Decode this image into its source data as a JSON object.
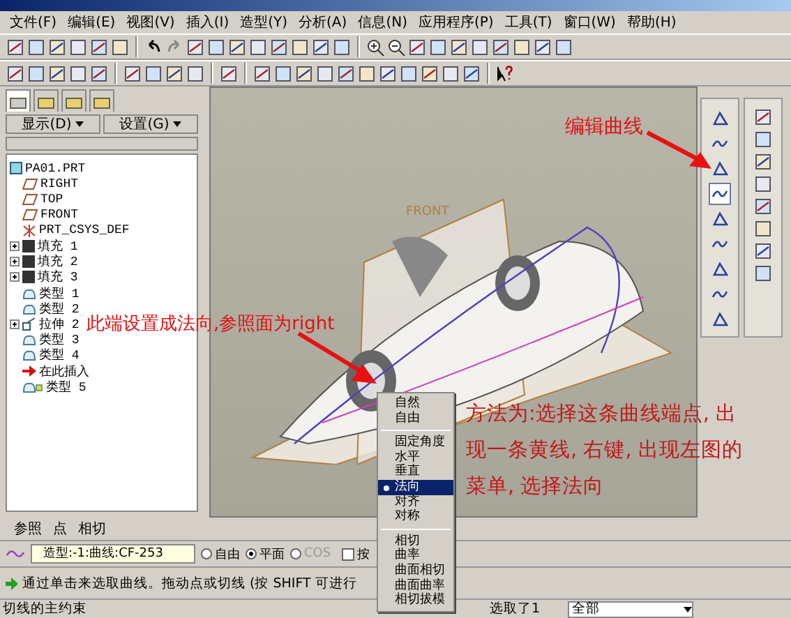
{
  "menu": [
    {
      "label": "文件(F)"
    },
    {
      "label": "编辑(E)"
    },
    {
      "label": "视图(V)"
    },
    {
      "label": "插入(I)"
    },
    {
      "label": "造型(Y)"
    },
    {
      "label": "分析(A)"
    },
    {
      "label": "信息(N)"
    },
    {
      "label": "应用程序(P)"
    },
    {
      "label": "工具(T)"
    },
    {
      "label": "窗口(W)"
    },
    {
      "label": "帮助(H)"
    }
  ],
  "tree_tabs": [
    {
      "selected": true
    },
    {
      "selected": false
    },
    {
      "selected": false
    },
    {
      "selected": false
    }
  ],
  "tree_buttons": [
    "显示(D)",
    "设置(G)"
  ],
  "tree": {
    "label": "PA01.PRT",
    "kind": "part",
    "children": [
      {
        "label": "RIGHT",
        "kind": "plane",
        "expandable": false
      },
      {
        "label": "TOP",
        "kind": "plane",
        "expandable": false
      },
      {
        "label": "FRONT",
        "kind": "plane",
        "expandable": false
      },
      {
        "label": "PRT_CSYS_DEF",
        "kind": "csys",
        "expandable": false
      },
      {
        "label": "填充 1",
        "kind": "fill",
        "expandable": true
      },
      {
        "label": "填充 2",
        "kind": "fill",
        "expandable": true
      },
      {
        "label": "填充 3",
        "kind": "fill",
        "expandable": true
      },
      {
        "label": "类型 1",
        "kind": "style",
        "expandable": false
      },
      {
        "label": "类型 2",
        "kind": "style",
        "expandable": false
      },
      {
        "label": "拉伸 2",
        "kind": "extrude",
        "expandable": true
      },
      {
        "label": "类型 3",
        "kind": "style",
        "expandable": false
      },
      {
        "label": "类型 4",
        "kind": "style",
        "expandable": false
      },
      {
        "label": "在此插入",
        "kind": "insert",
        "expandable": false
      },
      {
        "label": "类型 5",
        "kind": "style-active",
        "expandable": false
      }
    ]
  },
  "viewport": {
    "plane_label": "FRONT"
  },
  "right_tools": [
    {
      "active": false
    },
    {
      "active": false
    },
    {
      "active": false
    },
    {
      "active": true
    },
    {
      "active": false
    },
    {
      "active": false
    },
    {
      "active": false
    },
    {
      "active": false
    },
    {
      "active": false
    }
  ],
  "annotations": {
    "edit_curve": "编辑曲线",
    "end_note": "此端设置成法向,参照面为right",
    "method_note": [
      "方法为:选择这条曲线端点, 出",
      "现一条黄线, 右键, 出现左图的",
      "菜单, 选择法向"
    ]
  },
  "context_menu": [
    [
      {
        "label": "自然",
        "selected": false
      },
      {
        "label": "自由",
        "selected": false
      }
    ],
    [
      {
        "label": "固定角度",
        "selected": false
      },
      {
        "label": "水平",
        "selected": false
      },
      {
        "label": "垂直",
        "selected": false
      },
      {
        "label": "法向",
        "selected": true
      },
      {
        "label": "对齐",
        "selected": false
      },
      {
        "label": "对称",
        "selected": false
      }
    ],
    [
      {
        "label": "相切",
        "selected": false
      },
      {
        "label": "曲率",
        "selected": false
      },
      {
        "label": "曲面相切",
        "selected": false
      },
      {
        "label": "曲面曲率",
        "selected": false
      },
      {
        "label": "相切拔模",
        "selected": false
      }
    ]
  ],
  "dashboard": {
    "tabs": [
      "参照",
      "点",
      "相切"
    ],
    "curve_field": "造型:-1:曲线:CF-253",
    "options": [
      {
        "label": "自由",
        "selected": false,
        "disabled": false
      },
      {
        "label": "平面",
        "selected": true,
        "disabled": false
      },
      {
        "label": "COS",
        "selected": false,
        "disabled": true
      }
    ],
    "checkbox": {
      "label": "按",
      "checked": false
    },
    "message": "通过单击来选取曲线。拖动点或切线 (按 SHIFT 可进行"
  },
  "status_bar": {
    "left": "切线的主约束",
    "selection": "选取了1",
    "filter": "全部"
  }
}
